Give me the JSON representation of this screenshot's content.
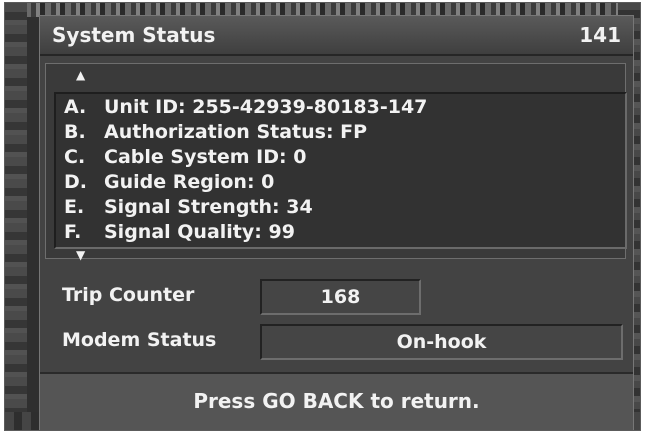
{
  "header": {
    "title": "System Status",
    "page_number": "141"
  },
  "status_list": {
    "scroll_up_icon": "triangle-up",
    "scroll_down_icon": "triangle-down",
    "items": [
      {
        "letter": "A.",
        "text": "Unit ID: 255-42939-80183-147"
      },
      {
        "letter": "B.",
        "text": "Authorization Status: FP"
      },
      {
        "letter": "C.",
        "text": "Cable System ID: 0"
      },
      {
        "letter": "D.",
        "text": "Guide Region: 0"
      },
      {
        "letter": "E.",
        "text": "Signal Strength: 34"
      },
      {
        "letter": "F.",
        "text": "Signal Quality: 99"
      }
    ]
  },
  "trip_counter": {
    "label": "Trip Counter",
    "value": "168"
  },
  "modem_status": {
    "label": "Modem Status",
    "value": "On-hook"
  },
  "footer": {
    "instruction": "Press GO BACK to return."
  }
}
